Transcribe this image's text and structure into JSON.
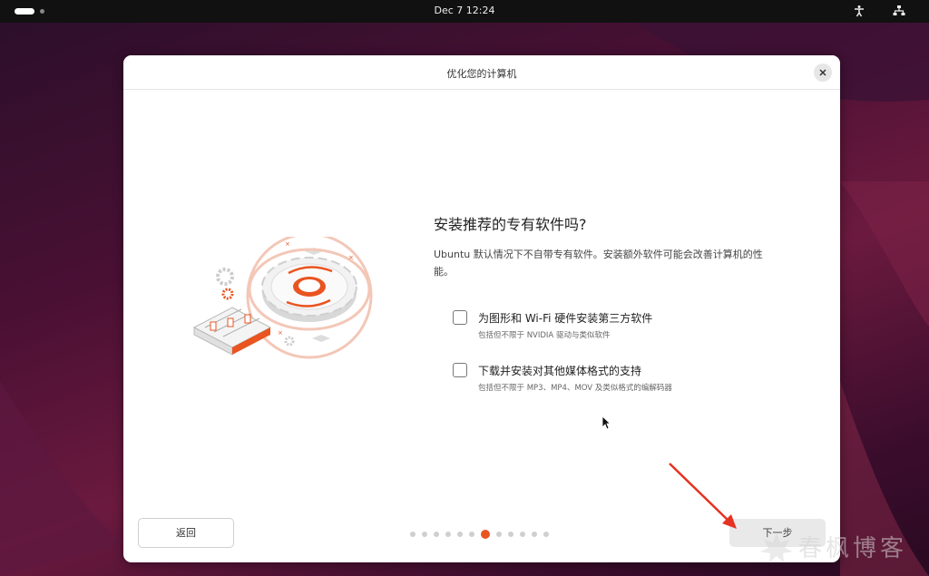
{
  "topbar": {
    "clock": "Dec 7  12:24",
    "tray_icons": [
      "accessibility-icon",
      "network-icon"
    ]
  },
  "window": {
    "title": "优化您的计算机",
    "heading": "安装推荐的专有软件吗?",
    "description": "Ubuntu 默认情况下不自带专有软件。安装额外软件可能会改善计算机的性能。",
    "options": [
      {
        "label": "为图形和 Wi-Fi 硬件安装第三方软件",
        "sublabel": "包括但不限于 NVIDIA 驱动与类似软件",
        "checked": false
      },
      {
        "label": "下载并安装对其他媒体格式的支持",
        "sublabel": "包括但不限于 MP3、MP4、MOV 及类似格式的编解码器",
        "checked": false
      }
    ],
    "back_label": "返回",
    "next_label": "下一步",
    "progress": {
      "total": 12,
      "current": 7
    }
  },
  "watermark": {
    "text": "春枫博客"
  },
  "colors": {
    "accent": "#e95420",
    "topbar": "#111111",
    "arrow": "#e53222"
  }
}
